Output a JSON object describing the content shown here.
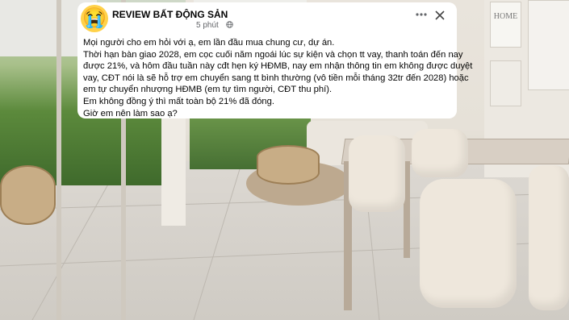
{
  "post": {
    "page_name": "REVIEW BẤT ĐỘNG SẢN",
    "time": "5 phút",
    "avatar_emoji": "😭",
    "lines": [
      "Mọi người cho em hỏi với ạ, em lần đầu mua chung cư, dự án.",
      "Thời hạn bàn giao 2028, em cọc cuối năm ngoái lúc sự kiện và chọn tt vay, thanh toán đến nay",
      "được 21%, và hôm đầu tuần này cđt hẹn ký HĐMB, nay em nhận thông tin em không được duyệt",
      "vay, CĐT nói là sẽ hỗ trợ em chuyển sang tt bình thường (vô tiền mỗi tháng 32tr đến 2028) hoặc",
      "em tự chuyển nhượng HĐMB (em tự tìm người, CĐT thu phí).",
      "Em không đồng ý thì mất toàn bộ 21% đã đóng.",
      "Giờ em nên làm sao ạ?"
    ]
  },
  "background": {
    "wall_art_text": "HOME"
  },
  "icons": {
    "globe": "globe-icon",
    "more": "more-icon",
    "close": "close-icon"
  },
  "colors": {
    "text": "#050505",
    "meta": "#65676b",
    "card": "#ffffff"
  }
}
